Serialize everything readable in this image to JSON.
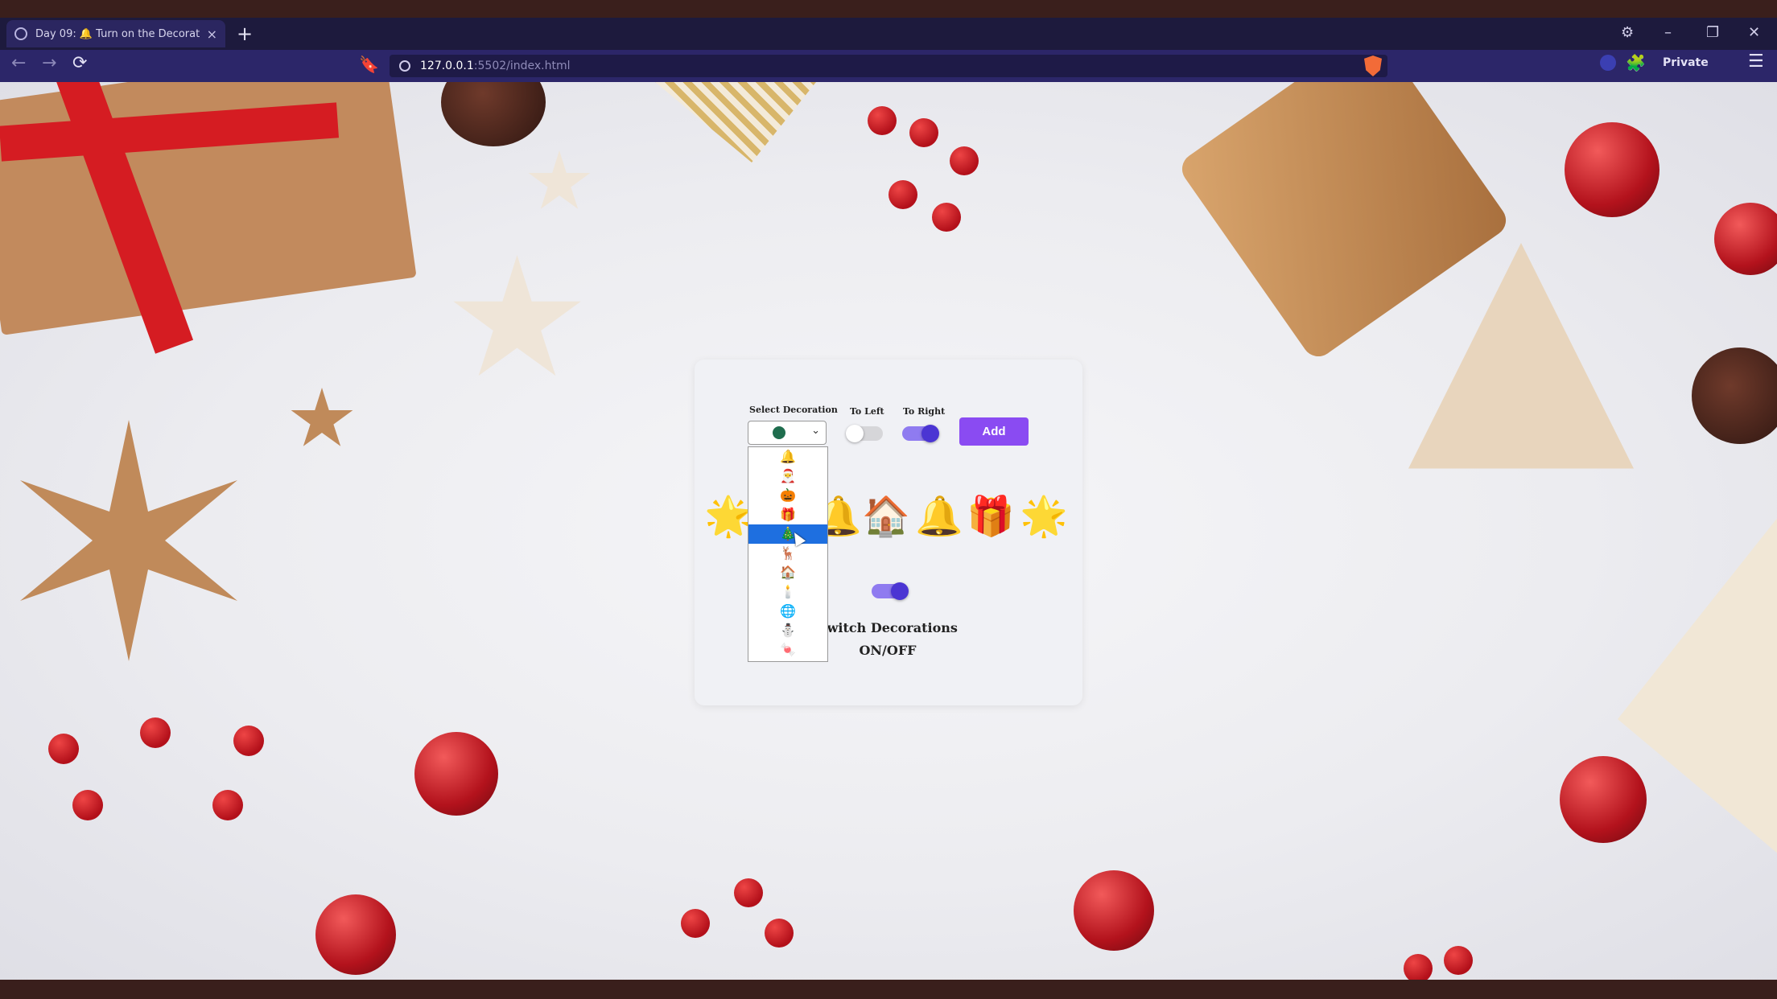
{
  "browser": {
    "tab_title": "Day 09: 🔔 Turn on the Decorati…",
    "tab_close": "×",
    "new_tab": "+",
    "url_host": "127.0.0.1",
    "url_path": ":5502/index.html",
    "private_label": "Private",
    "bookmark_icon": "🔖",
    "extensions_icon": "🧩",
    "menu_icon": "☰",
    "back_icon": "←",
    "forward_icon": "→",
    "reload_icon": "⟳",
    "minimize_icon": "–",
    "maximize_icon": "❐",
    "close_icon": "✕",
    "profile_icon": "⚙"
  },
  "form": {
    "select_label": "Select Decoration",
    "to_left_label": "To Left",
    "to_right_label": "To Right",
    "add_label": "Add",
    "selected_value": "🌐",
    "to_left_on": false,
    "to_right_on": true
  },
  "dropdown": {
    "options": [
      "🔔",
      "🎅",
      "🎃",
      "🎁",
      "🎄",
      "🦌",
      "🏠",
      "🕯️",
      "🌐",
      "⛄",
      "🍬"
    ],
    "selected_index": 4
  },
  "decorations": [
    "🌟",
    "🔔",
    "🏠",
    "🔔",
    "🎁",
    "🌟"
  ],
  "switch": {
    "label_line1": "Switch Decorations",
    "label_line2": "ON/OFF",
    "on": true
  }
}
